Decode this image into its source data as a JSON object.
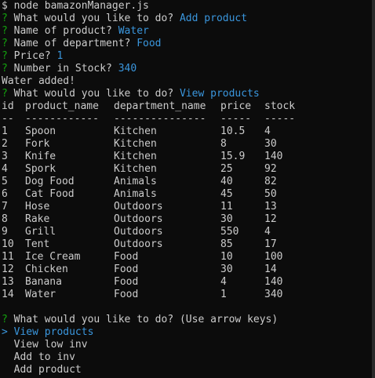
{
  "prompt": {
    "dollar": "$",
    "command": "node bamazonManager.js",
    "q_mark": "?"
  },
  "session": {
    "q1": {
      "question": "What would you like to do?",
      "answer": "Add product"
    },
    "q2": {
      "question": "Name of product?",
      "answer": "Water"
    },
    "q3": {
      "question": "Name of department?",
      "answer": "Food"
    },
    "q4": {
      "question": "Price?",
      "answer": "1"
    },
    "q5": {
      "question": "Number in Stock?",
      "answer": "340"
    },
    "result": "Water added!",
    "q6": {
      "question": "What would you like to do?",
      "answer": "View products"
    }
  },
  "table": {
    "headers": {
      "id": "id",
      "product_name": "product_name",
      "department_name": "department_name",
      "price": "price",
      "stock": "stock"
    },
    "separators": {
      "id": "--",
      "product_name": "------------",
      "department_name": "---------------",
      "price": "-----",
      "stock": "-----"
    },
    "rows": [
      {
        "id": "1",
        "product_name": "Spoon",
        "department_name": "Kitchen",
        "price": "10.5",
        "stock": "4"
      },
      {
        "id": "2",
        "product_name": "Fork",
        "department_name": "Kitchen",
        "price": "8",
        "stock": "30"
      },
      {
        "id": "3",
        "product_name": "Knife",
        "department_name": "Kitchen",
        "price": "15.9",
        "stock": "140"
      },
      {
        "id": "4",
        "product_name": "Spork",
        "department_name": "Kitchen",
        "price": "25",
        "stock": "92"
      },
      {
        "id": "5",
        "product_name": "Dog Food",
        "department_name": "Animals",
        "price": "40",
        "stock": "82"
      },
      {
        "id": "6",
        "product_name": "Cat Food",
        "department_name": "Animals",
        "price": "45",
        "stock": "50"
      },
      {
        "id": "7",
        "product_name": "Hose",
        "department_name": "Outdoors",
        "price": "11",
        "stock": "13"
      },
      {
        "id": "8",
        "product_name": "Rake",
        "department_name": "Outdoors",
        "price": "30",
        "stock": "12"
      },
      {
        "id": "9",
        "product_name": "Grill",
        "department_name": "Outdoors",
        "price": "550",
        "stock": "4"
      },
      {
        "id": "10",
        "product_name": "Tent",
        "department_name": "Outdoors",
        "price": "85",
        "stock": "17"
      },
      {
        "id": "11",
        "product_name": "Ice Cream",
        "department_name": "Food",
        "price": "10",
        "stock": "100"
      },
      {
        "id": "12",
        "product_name": "Chicken",
        "department_name": "Food",
        "price": "30",
        "stock": "14"
      },
      {
        "id": "13",
        "product_name": "Banana",
        "department_name": "Food",
        "price": "4",
        "stock": "140"
      },
      {
        "id": "14",
        "product_name": "Water",
        "department_name": "Food",
        "price": "1",
        "stock": "340"
      }
    ]
  },
  "menu": {
    "question": "What would you like to do?",
    "hint": "(Use arrow keys)",
    "pointer": ">",
    "selected": "View products",
    "options": [
      "View low inv",
      "Add to inv",
      "Add product"
    ]
  },
  "colors": {
    "background": "#0c0c0c",
    "text": "#cccccc",
    "prompt_green": "#13a10e",
    "answer_blue": "#3a96dd"
  }
}
